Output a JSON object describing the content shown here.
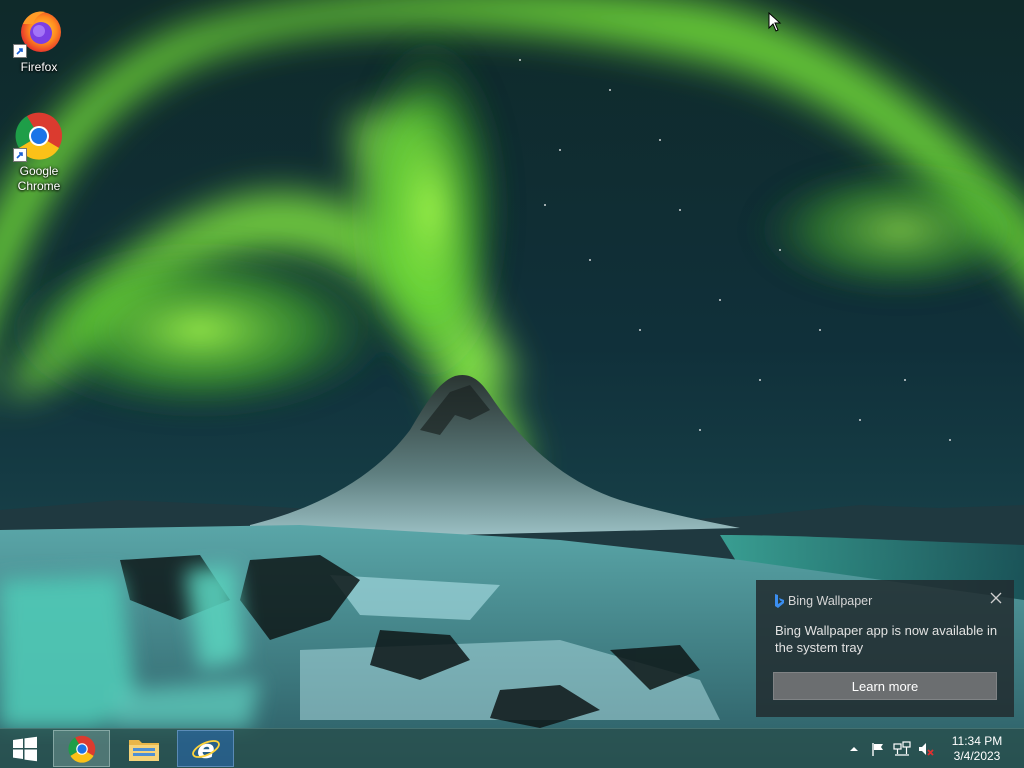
{
  "desktop": {
    "icons": [
      {
        "label": "Firefox",
        "icon": "firefox-icon"
      },
      {
        "label": "Google Chrome",
        "icon": "chrome-icon"
      }
    ]
  },
  "toast": {
    "app_name": "Bing Wallpaper",
    "message": "Bing Wallpaper app is now available in the system tray",
    "button_label": "Learn more",
    "close_icon": "close-icon"
  },
  "taskbar": {
    "start_icon": "windows-start-icon",
    "pinned": [
      {
        "name": "chrome-taskbar-button",
        "icon": "chrome-icon",
        "active": true
      },
      {
        "name": "file-explorer-taskbar-button",
        "icon": "folder-icon",
        "active": false
      },
      {
        "name": "internet-explorer-taskbar-button",
        "icon": "internet-explorer-icon",
        "active": false
      }
    ],
    "tray_icons": [
      "chevron-up-icon",
      "flag-icon",
      "network-icon",
      "speaker-muted-icon"
    ],
    "clock": {
      "time": "11:34 PM",
      "date": "3/4/2023"
    }
  },
  "colors": {
    "aurora": "#7be03a",
    "taskbar": "#284e4c",
    "toast_bg": "#222c30",
    "toast_button": "#6b6e70"
  }
}
